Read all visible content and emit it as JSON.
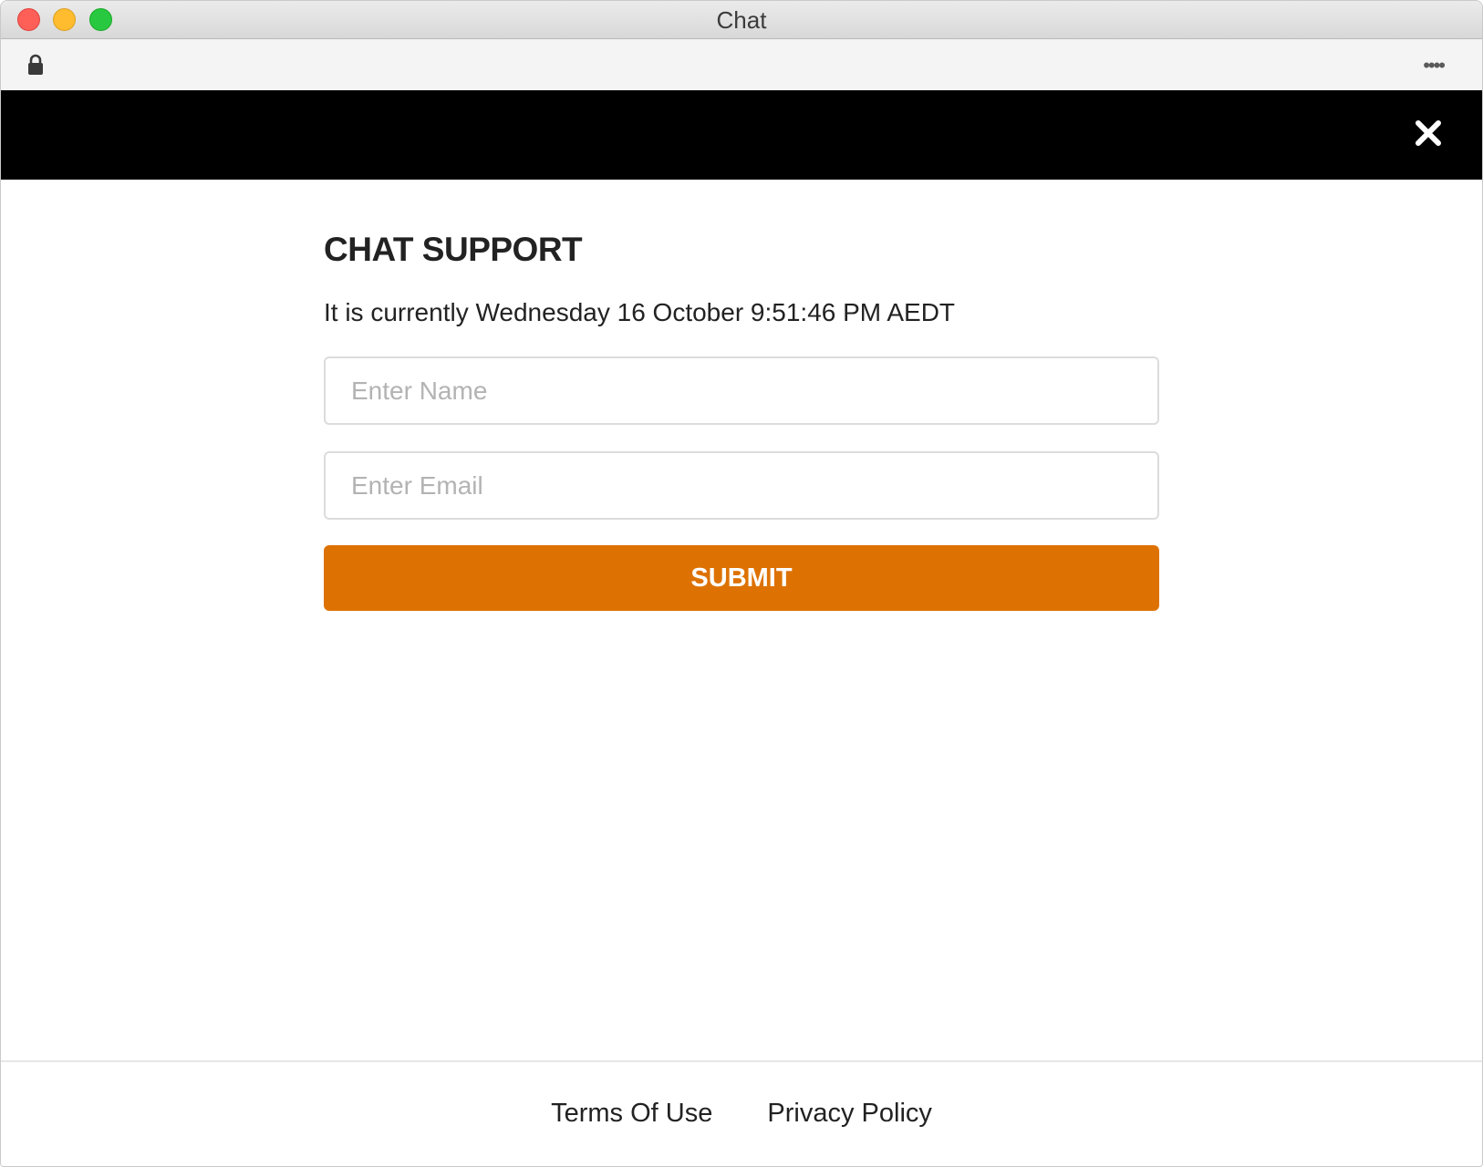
{
  "window": {
    "title": "Chat"
  },
  "toolbar": {
    "more_icon": "••••"
  },
  "chat": {
    "heading": "CHAT SUPPORT",
    "current_time": "It is currently Wednesday 16 October 9:51:46 PM AEDT",
    "name_placeholder": "Enter Name",
    "email_placeholder": "Enter Email",
    "submit_label": "SUBMIT"
  },
  "footer": {
    "links": [
      {
        "label": "Terms Of Use"
      },
      {
        "label": "Privacy Policy"
      }
    ]
  },
  "colors": {
    "header": "#000000",
    "accent": "#dd7203",
    "text": "#222222"
  },
  "icons": {
    "lock": "lock-icon",
    "close": "close-icon",
    "more": "more-icon"
  }
}
